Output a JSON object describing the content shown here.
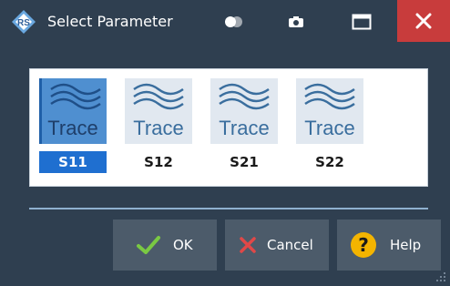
{
  "window": {
    "title": "Select Parameter"
  },
  "tiles": [
    {
      "icon_text": "Trace",
      "param": "S11",
      "selected": true
    },
    {
      "icon_text": "Trace",
      "param": "S12",
      "selected": false
    },
    {
      "icon_text": "Trace",
      "param": "S21",
      "selected": false
    },
    {
      "icon_text": "Trace",
      "param": "S22",
      "selected": false
    }
  ],
  "buttons": {
    "ok_label": "OK",
    "cancel_label": "Cancel",
    "help_label": "Help"
  },
  "icons": {
    "logo": "rohde-schwarz-logo-icon",
    "toggle": "transparency-toggle-icon",
    "screenshot": "camera-icon",
    "maximize": "maximize-icon",
    "close": "close-icon",
    "ok": "checkmark-icon",
    "cancel": "x-icon",
    "help": "question-icon"
  },
  "colors": {
    "background": "#2f3f50",
    "close": "#c83c3c",
    "selected_label": "#1f6fd0",
    "tile_bg": "#e1e8f0",
    "trace_text": "#3a6e9e",
    "checkmark": "#7ac943",
    "cancel_x": "#e04848",
    "help_circle": "#f4b400"
  }
}
